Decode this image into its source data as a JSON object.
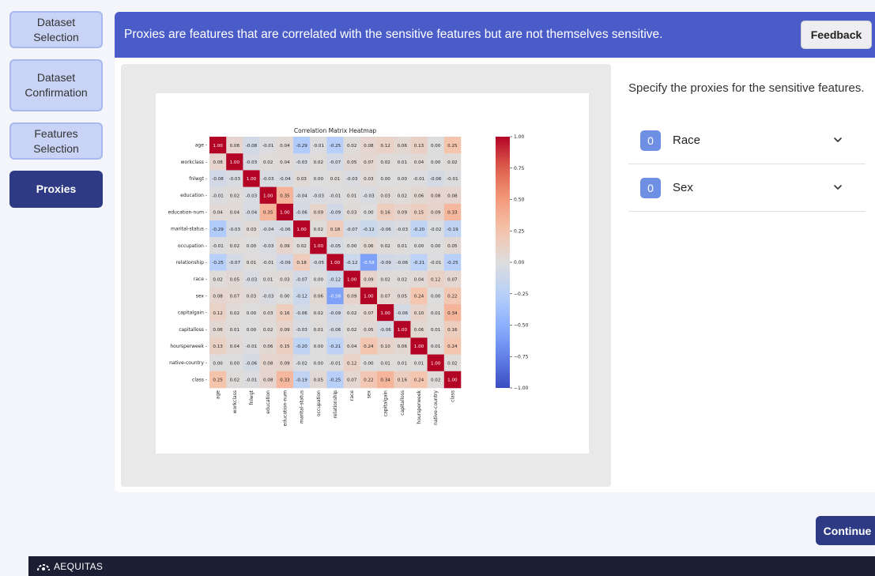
{
  "sidebar": {
    "items": [
      {
        "label": "Dataset Selection"
      },
      {
        "label": "Dataset Confirmation"
      },
      {
        "label": "Features Selection"
      },
      {
        "label": "Proxies"
      }
    ]
  },
  "header": {
    "text": "Proxies are features that are correlated with the sensitive features but are not themselves sensitive.",
    "feedback_label": "Feedback"
  },
  "proxies": {
    "title": "Specify the proxies for the sensitive features.",
    "items": [
      {
        "count": "0",
        "label": "Race"
      },
      {
        "count": "0",
        "label": "Sex"
      }
    ]
  },
  "continue_label": "Continue",
  "footer": {
    "brand": "AEQUITAS"
  },
  "colors": {
    "header": "#4a5cc8",
    "active_nav": "#2e3b84",
    "badge": "#6e8fe3"
  },
  "chart_data": {
    "type": "heatmap",
    "title": "Correlation Matrix Heatmap",
    "features": [
      "age",
      "workclass",
      "fnlwgt",
      "education",
      "education-num",
      "marital-status",
      "occupation",
      "relationship",
      "race",
      "sex",
      "capitalgain",
      "capitalloss",
      "hoursperweek",
      "native-country",
      "class"
    ],
    "matrix": [
      [
        1.0,
        0.08,
        -0.08,
        -0.01,
        0.04,
        -0.29,
        -0.01,
        -0.25,
        0.02,
        0.08,
        0.12,
        0.06,
        0.13,
        -0.0,
        0.25
      ],
      [
        0.08,
        1.0,
        -0.03,
        0.02,
        0.04,
        -0.03,
        0.02,
        -0.07,
        0.05,
        0.07,
        0.02,
        0.01,
        0.04,
        0.0,
        0.02
      ],
      [
        -0.08,
        -0.03,
        1.0,
        -0.03,
        -0.04,
        0.03,
        -0.0,
        0.01,
        -0.03,
        0.03,
        -0.0,
        -0.0,
        -0.01,
        -0.06,
        -0.01
      ],
      [
        -0.01,
        0.02,
        -0.03,
        1.0,
        0.35,
        -0.04,
        -0.03,
        -0.01,
        0.01,
        -0.03,
        0.03,
        0.02,
        0.06,
        0.08,
        0.08
      ],
      [
        0.04,
        0.04,
        -0.04,
        0.35,
        1.0,
        -0.06,
        0.09,
        -0.09,
        0.03,
        0.0,
        0.16,
        0.09,
        0.15,
        0.09,
        0.33
      ],
      [
        -0.29,
        -0.03,
        0.03,
        -0.04,
        -0.06,
        1.0,
        0.02,
        0.18,
        -0.07,
        -0.12,
        -0.06,
        -0.03,
        -0.2,
        -0.02,
        -0.19
      ],
      [
        -0.01,
        0.02,
        -0.0,
        -0.03,
        0.09,
        0.02,
        1.0,
        -0.05,
        -0.0,
        0.06,
        0.02,
        0.01,
        0.0,
        -0.0,
        0.05
      ],
      [
        -0.25,
        -0.07,
        0.01,
        -0.01,
        -0.09,
        0.18,
        -0.05,
        1.0,
        -0.12,
        -0.58,
        -0.09,
        -0.06,
        -0.21,
        -0.01,
        -0.25
      ],
      [
        0.02,
        0.05,
        -0.03,
        0.01,
        0.03,
        -0.07,
        -0.0,
        -0.12,
        1.0,
        0.09,
        0.02,
        0.02,
        0.04,
        0.12,
        0.07
      ],
      [
        0.08,
        0.07,
        0.03,
        -0.03,
        0.0,
        -0.12,
        0.06,
        -0.58,
        0.09,
        1.0,
        0.07,
        0.05,
        0.24,
        -0.0,
        0.22
      ],
      [
        0.12,
        0.02,
        -0.0,
        0.03,
        0.16,
        -0.06,
        0.02,
        -0.09,
        0.02,
        0.07,
        1.0,
        -0.06,
        0.1,
        0.01,
        0.34
      ],
      [
        0.06,
        0.01,
        -0.0,
        0.02,
        0.09,
        -0.03,
        0.01,
        -0.06,
        0.02,
        0.05,
        -0.06,
        1.0,
        0.06,
        0.01,
        0.16
      ],
      [
        0.13,
        0.04,
        -0.01,
        0.06,
        0.15,
        -0.2,
        0.0,
        -0.21,
        0.04,
        0.24,
        0.1,
        0.06,
        1.0,
        0.01,
        0.24
      ],
      [
        -0.0,
        0.0,
        -0.06,
        0.08,
        0.09,
        -0.02,
        -0.0,
        -0.01,
        0.12,
        -0.0,
        0.01,
        0.01,
        0.01,
        1.0,
        0.02
      ],
      [
        0.25,
        0.02,
        -0.01,
        0.08,
        0.33,
        -0.19,
        0.05,
        -0.25,
        0.07,
        0.22,
        0.34,
        0.16,
        0.24,
        0.02,
        1.0
      ]
    ],
    "colorbar_ticks": [
      "1.00",
      "0.75",
      "0.50",
      "0.25",
      "0.00",
      "−0.25",
      "−0.50",
      "−0.75",
      "−1.00"
    ],
    "vmin": -1,
    "vmax": 1,
    "colormap": "coolwarm"
  }
}
